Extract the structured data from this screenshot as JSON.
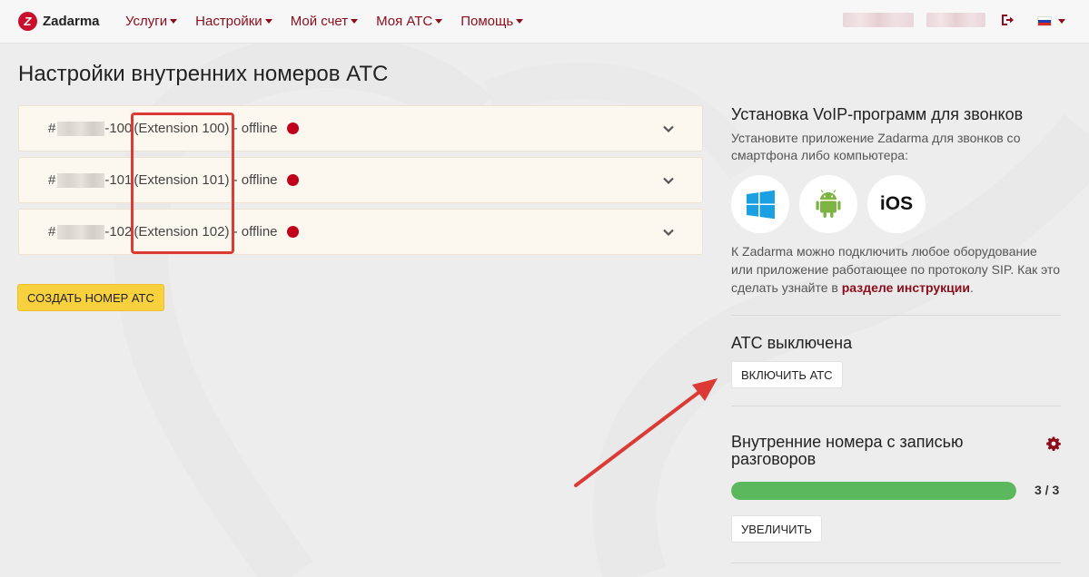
{
  "topbar": {
    "logo_text": "Zadarma",
    "nav": [
      {
        "label": "Услуги"
      },
      {
        "label": "Настройки"
      },
      {
        "label": "Мой счет"
      },
      {
        "label": "Моя АТС"
      },
      {
        "label": "Помощь"
      }
    ],
    "logout_icon": "logout-icon",
    "language_flag": "russia-flag"
  },
  "page_title": "Настройки внутренних номеров АТС",
  "extensions": [
    {
      "prefix": "#",
      "suffix": "-100",
      "name": "(Extension 100)",
      "status": " - offline"
    },
    {
      "prefix": "#",
      "suffix": "-101",
      "name": "(Extension 101)",
      "status": " - offline"
    },
    {
      "prefix": "#",
      "suffix": "-102",
      "name": "(Extension 102)",
      "status": " - offline"
    }
  ],
  "create_button": "СОЗДАТЬ НОМЕР АТС",
  "voip": {
    "title": "Установка VoIP-программ для звонков",
    "text": "Установите приложение Zadarma для звонков со смартфона либо компьютера:",
    "apps": [
      "windows-icon",
      "android-icon",
      "iOS"
    ],
    "sip_text_before": "К Zadarma можно подключить любое оборудование или приложение работающее по протоколу SIP. Как это сделать узнайте в ",
    "sip_link": "разделе инструкции",
    "sip_text_after": "."
  },
  "pbx": {
    "title": "АТС выключена",
    "enable_button": "ВКЛЮЧИТЬ АТС"
  },
  "recording": {
    "title": "Внутренние номера с записью разговоров",
    "count": "3 / 3",
    "progress": 1.0,
    "increase_button": "УВЕЛИЧИТЬ"
  },
  "colors": {
    "brand": "#8b0d1c",
    "status_offline": "#c0001a",
    "progress": "#5cb85c",
    "create_button": "#f9d13e",
    "highlight": "#dc3b35"
  }
}
